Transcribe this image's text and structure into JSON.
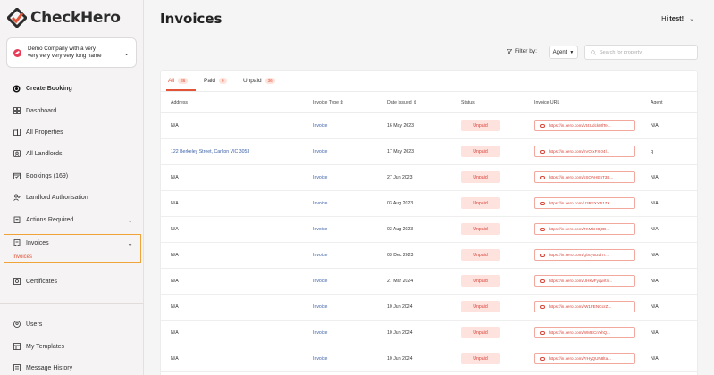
{
  "app": {
    "brand": "CheckHero",
    "accent": "#e25338"
  },
  "company": {
    "name_line1": "Demo Company with a very",
    "name_line2": "very very very very long name"
  },
  "sidebar": {
    "items": [
      {
        "label": "Create Booking",
        "icon": "plus-circle-icon"
      },
      {
        "label": "Dashboard",
        "icon": "grid-icon"
      },
      {
        "label": "All Properties",
        "icon": "building-icon"
      },
      {
        "label": "All Landlords",
        "icon": "id-card-icon"
      },
      {
        "label": "Bookings (169)",
        "icon": "calendar-check-icon"
      },
      {
        "label": "Landlord Authorisation",
        "icon": "user-check-icon"
      },
      {
        "label": "Actions Required",
        "icon": "clipboard-icon"
      },
      {
        "label": "Invoices",
        "icon": "receipt-icon"
      },
      {
        "label": "Certificates",
        "icon": "certificate-icon"
      },
      {
        "label": "Users",
        "icon": "user-circle-icon"
      },
      {
        "label": "My Templates",
        "icon": "template-icon"
      },
      {
        "label": "Message History",
        "icon": "message-history-icon"
      }
    ],
    "invoices_sub": "Invoices"
  },
  "header": {
    "title": "Invoices",
    "greeting_prefix": "Hi ",
    "user": "test!"
  },
  "filter": {
    "label": "Filter by:",
    "agent_button": "Agent",
    "search_placeholder": "Search for property"
  },
  "tabs": [
    {
      "label": "All",
      "count": "36"
    },
    {
      "label": "Paid",
      "count": "0"
    },
    {
      "label": "Unpaid",
      "count": "36"
    }
  ],
  "table": {
    "headers": [
      "Address",
      "Invoice Type",
      "Date Issued",
      "Status",
      "Invoice URL",
      "Agent"
    ],
    "rows": [
      {
        "address": "N/A",
        "type": "Invoice",
        "date": "16 May 2023",
        "status": "Unpaid",
        "url": "https://in.xero.com/Vt4UdckMlTe...",
        "agent": "N/A"
      },
      {
        "address": "122 Berkeley Street, Carlton VIC 3053",
        "type": "Invoice",
        "date": "17 May 2023",
        "status": "Unpaid",
        "url": "https://in.xero.com/hVOIxFXO4l...",
        "agent": "q"
      },
      {
        "address": "N/A",
        "type": "Invoice",
        "date": "27 Jun 2023",
        "status": "Unpaid",
        "url": "https://in.xero.com/bSOAHE5T3B...",
        "agent": "N/A"
      },
      {
        "address": "N/A",
        "type": "Invoice",
        "date": "03 Aug 2023",
        "status": "Unpaid",
        "url": "https://in.xero.com/U3RFXYD1ZK...",
        "agent": "N/A"
      },
      {
        "address": "N/A",
        "type": "Invoice",
        "date": "03 Aug 2023",
        "status": "Unpaid",
        "url": "https://in.xero.com/TKMbHBj0D...",
        "agent": "N/A"
      },
      {
        "address": "N/A",
        "type": "Invoice",
        "date": "03 Dec 2023",
        "status": "Unpaid",
        "url": "https://in.xero.com/Qbcy5tzdhT...",
        "agent": "N/A"
      },
      {
        "address": "N/A",
        "type": "Invoice",
        "date": "27 Mar 2024",
        "status": "Unpaid",
        "url": "https://in.xero.com/UHKvFyqwrtn...",
        "agent": "N/A"
      },
      {
        "address": "N/A",
        "type": "Invoice",
        "date": "10 Jun 2024",
        "status": "Unpaid",
        "url": "https://in.xero.com/IW1FENGcrZ...",
        "agent": "N/A"
      },
      {
        "address": "N/A",
        "type": "Invoice",
        "date": "10 Jun 2024",
        "status": "Unpaid",
        "url": "https://in.xero.com/WMECnYhQ...",
        "agent": "N/A"
      },
      {
        "address": "N/A",
        "type": "Invoice",
        "date": "10 Jun 2024",
        "status": "Unpaid",
        "url": "https://in.xero.com/7rHyQUN8lta...",
        "agent": "N/A"
      }
    ]
  }
}
